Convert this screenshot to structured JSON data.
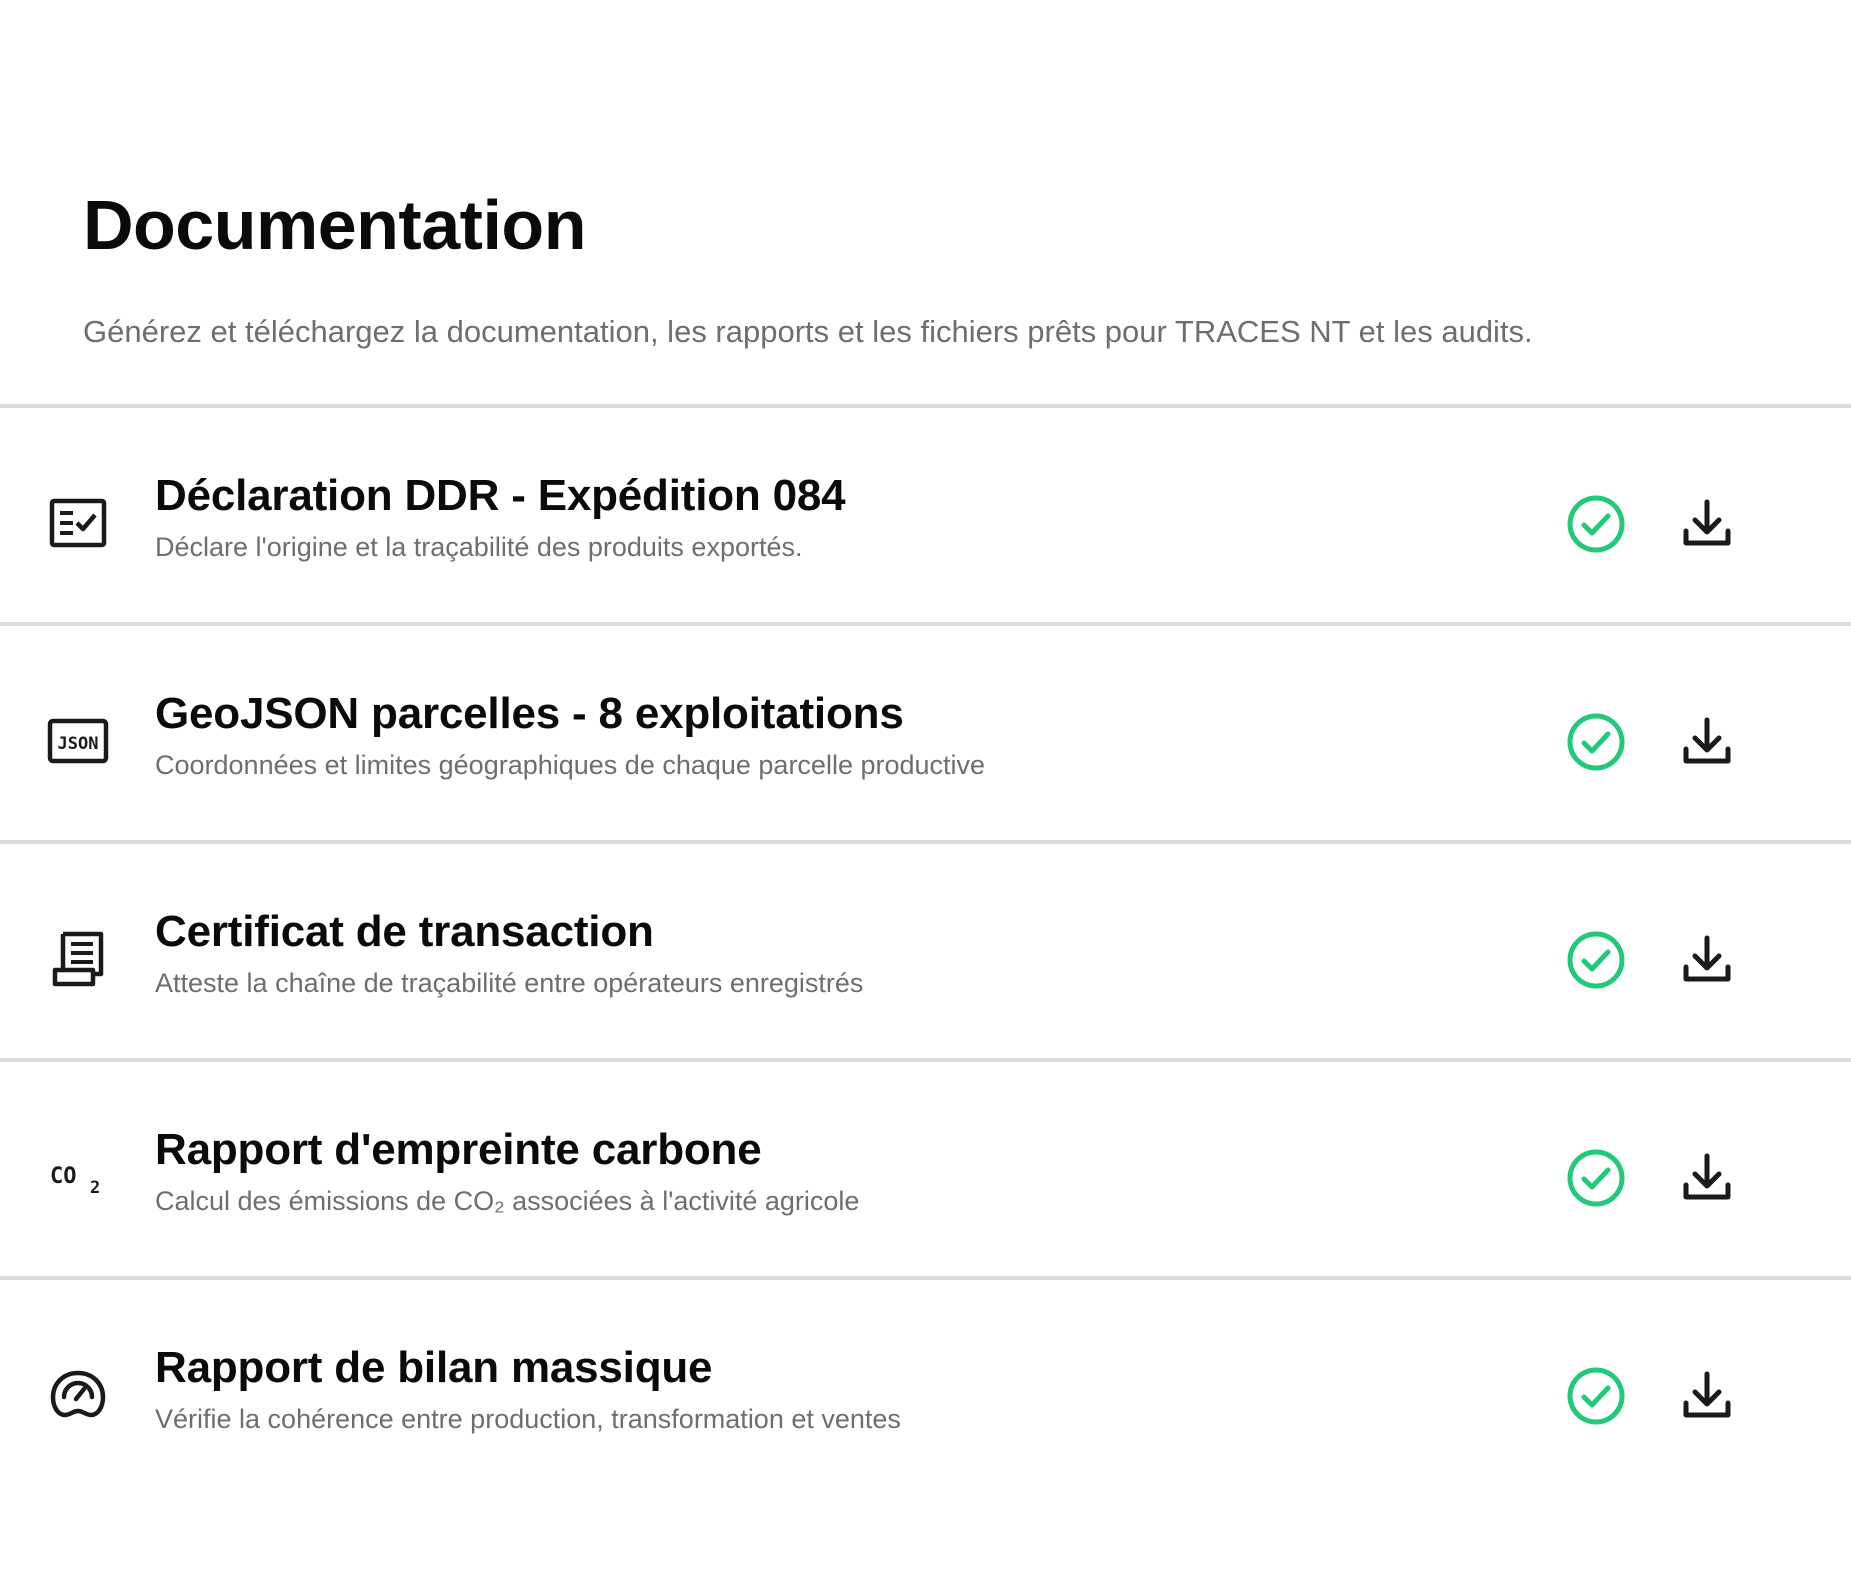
{
  "header": {
    "title": "Documentation",
    "subtitle": "Générez et téléchargez la documentation, les rapports et les fichiers prêts pour TRACES NT et les audits."
  },
  "colors": {
    "status_ok": "#22c97a",
    "text_primary": "#0a0a0a",
    "text_secondary": "#6e6e6e",
    "divider": "#dcdcdc"
  },
  "documents": [
    {
      "icon": "form-checklist-icon",
      "title": "Déclaration DDR - Expédition 084",
      "description": "Déclare l'origine et la traçabilité des produits exportés.",
      "status_icon": "check-circle-icon",
      "action_icon": "download-icon"
    },
    {
      "icon": "json-file-icon",
      "icon_text": "JSON",
      "title": "GeoJSON parcelles - 8 exploitations",
      "description": "Coordonnées et limites géographiques de chaque parcelle productive",
      "status_icon": "check-circle-icon",
      "action_icon": "download-icon"
    },
    {
      "icon": "receipt-certificate-icon",
      "title": "Certificat de transaction",
      "description": "Atteste la chaîne de traçabilité entre opérateurs enregistrés",
      "status_icon": "check-circle-icon",
      "action_icon": "download-icon"
    },
    {
      "icon": "co2-icon",
      "icon_text": "CO",
      "icon_subscript": "2",
      "title": "Rapport d'empreinte carbone",
      "description": "Calcul des émissions de CO₂ associées à l'activité agricole",
      "status_icon": "check-circle-icon",
      "action_icon": "download-icon"
    },
    {
      "icon": "gauge-balance-icon",
      "title": "Rapport de bilan massique",
      "description": "Vérifie la cohérence entre production, transformation et ventes",
      "status_icon": "check-circle-icon",
      "action_icon": "download-icon"
    }
  ]
}
